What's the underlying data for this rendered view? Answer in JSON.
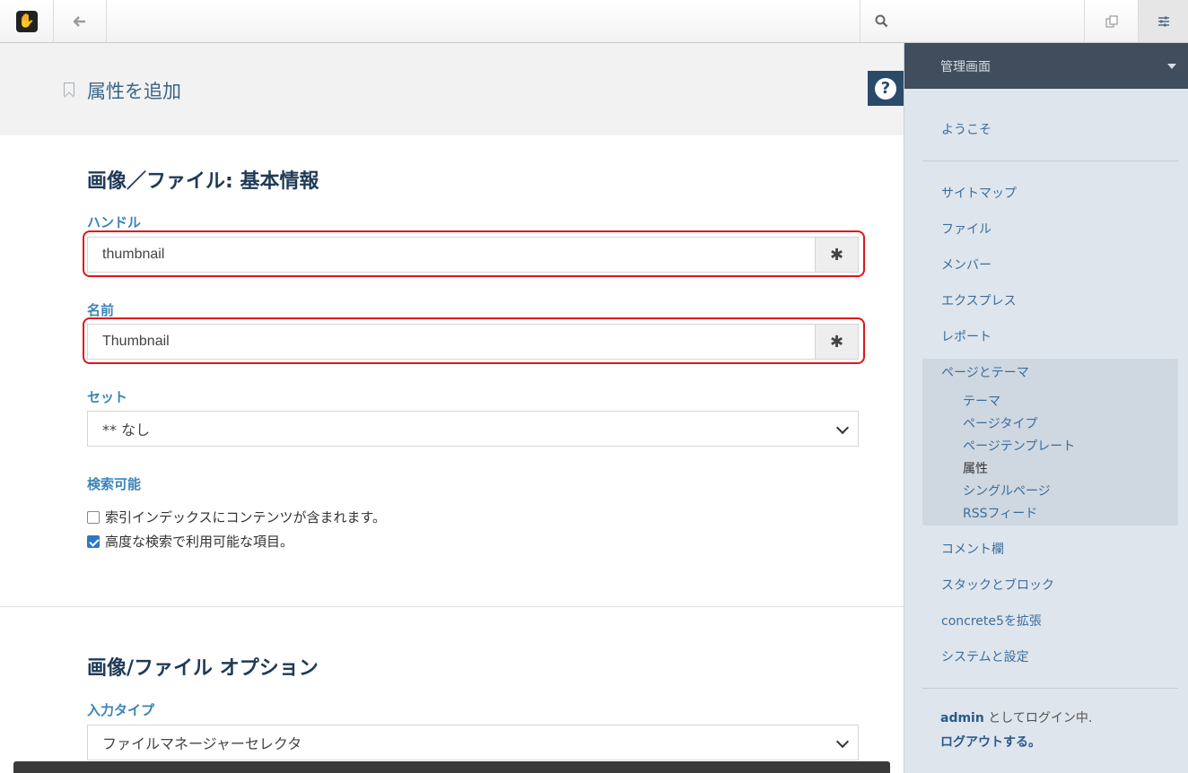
{
  "toolbar": {
    "logo_glyph": "✋",
    "back_icon": "back-arrow-icon",
    "search_icon": "search-icon",
    "pages_icon": "pages-icon",
    "settings_icon": "sliders-icon"
  },
  "header": {
    "title": "属性を追加",
    "help_label": "?"
  },
  "form": {
    "basic_heading": "画像／ファイル: 基本情報",
    "handle_label": "ハンドル",
    "handle_value": "thumbnail",
    "name_label": "名前",
    "name_value": "Thumbnail",
    "required_glyph": "✱",
    "set_label": "セット",
    "set_value": "** なし",
    "searchable_label": "検索可能",
    "checkbox_index": {
      "label": "索引インデックスにコンテンツが含まれます。",
      "checked": false
    },
    "checkbox_advanced": {
      "label": "高度な検索で利用可能な項目。",
      "checked": true
    },
    "options_heading": "画像/ファイル オプション",
    "input_type_label": "入力タイプ",
    "input_type_value": "ファイルマネージャーセレクタ"
  },
  "sidebar": {
    "header": "管理画面",
    "welcome": "ようこそ",
    "items": [
      "サイトマップ",
      "ファイル",
      "メンバー",
      "エクスプレス",
      "レポート"
    ],
    "pages_group": "ページとテーマ",
    "sub_items": [
      "テーマ",
      "ページタイプ",
      "ページテンプレート",
      "属性",
      "シングルページ",
      "RSSフィード"
    ],
    "active_sub": "属性",
    "items_after": [
      "コメント欄",
      "スタックとブロック",
      "concrete5を拡張",
      "システムと設定"
    ],
    "user_name": "admin",
    "user_suffix": " としてログイン中.",
    "logout": "ログアウトする。"
  },
  "colors": {
    "accent": "#3a84b8",
    "highlight": "#e0161b",
    "sidebar_header": "#3f4d5c"
  }
}
